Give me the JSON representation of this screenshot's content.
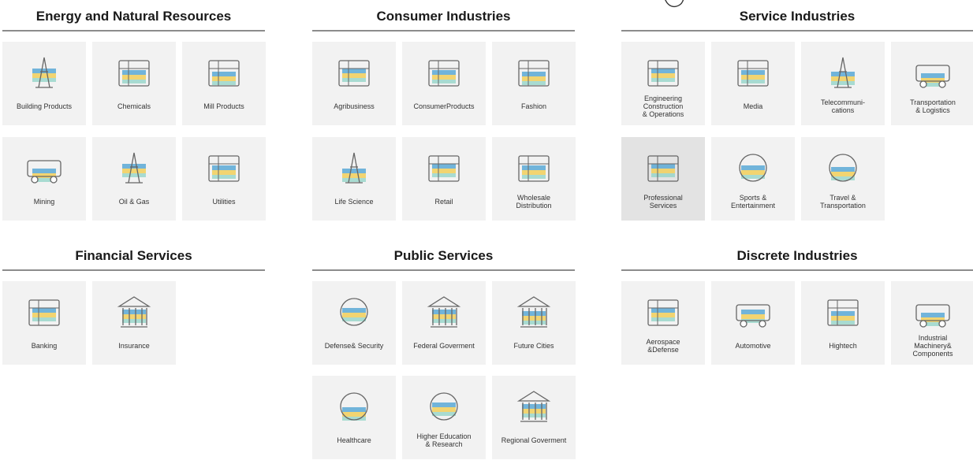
{
  "groups": {
    "energy": {
      "title": "Energy and  Natural Resources",
      "tiles": [
        {
          "label": "Building Products",
          "icon": "crane-building-icon"
        },
        {
          "label": "Chemicals",
          "icon": "chemical-plant-icon"
        },
        {
          "label": "Mill Products",
          "icon": "mill-rack-icon"
        },
        {
          "label": "Mining",
          "icon": "mine-cart-icon"
        },
        {
          "label": "Oil & Gas",
          "icon": "oil-rig-icon"
        },
        {
          "label": "Utilities",
          "icon": "power-plug-icon"
        }
      ]
    },
    "consumer": {
      "title": "Consumer Industries",
      "tiles": [
        {
          "label": "Agribusiness",
          "icon": "tractor-icon"
        },
        {
          "label": "ConsumerProducts",
          "icon": "shopping-bag-icon"
        },
        {
          "label": "Fashion",
          "icon": "dress-on-hanger-icon"
        },
        {
          "label": "Life Science",
          "icon": "microscope-icon"
        },
        {
          "label": "Retail",
          "icon": "retail-shoppers-icon"
        },
        {
          "label": "Wholesale\nDistribution",
          "icon": "forklift-worker-icon"
        }
      ]
    },
    "service": {
      "title": "Service Industries",
      "tiles": [
        {
          "label": "Engineering\nConstruction\n& Operations",
          "icon": "engineering-machine-icon"
        },
        {
          "label": "Media",
          "icon": "media-bubbles-icon"
        },
        {
          "label": "Telecommuni-\ncations",
          "icon": "antenna-tower-icon"
        },
        {
          "label": "Transportation\n& Logistics",
          "icon": "delivery-truck-icon"
        },
        {
          "label": "Professional\nServices",
          "icon": "briefcase-icon"
        },
        {
          "label": "Sports &\nEntertainment",
          "icon": "soccer-ball-icon"
        },
        {
          "label": "Travel &\nTransportation",
          "icon": "globe-icon"
        }
      ]
    },
    "financial": {
      "title": "Financial Services",
      "tiles": [
        {
          "label": "Banking",
          "icon": "money-stack-icon"
        },
        {
          "label": "Insurance",
          "icon": "insurance-house-icon"
        }
      ]
    },
    "public": {
      "title": "Public Services",
      "tiles": [
        {
          "label": "Defense& Security",
          "icon": "shield-icon"
        },
        {
          "label": "Federal Goverment",
          "icon": "capitol-building-icon"
        },
        {
          "label": "Future Cities",
          "icon": "city-skyline-icon"
        },
        {
          "label": "Healthcare",
          "icon": "medical-cross-icon"
        },
        {
          "label": "Higher Education\n& Research",
          "icon": "graduation-globe-icon"
        },
        {
          "label": "Regional Goverment",
          "icon": "columns-building-icon"
        }
      ]
    },
    "discrete": {
      "title": "Discrete Industries",
      "tiles": [
        {
          "label": "Aerospace\n&Defense",
          "icon": "airplane-icon"
        },
        {
          "label": "Automotive",
          "icon": "car-icon"
        },
        {
          "label": "Hightech",
          "icon": "circuit-chip-icon"
        },
        {
          "label": "Industrial\nMachinery&\nComponents",
          "icon": "conveyor-belt-icon"
        }
      ]
    }
  },
  "selected_tile": "Professional\nServices",
  "colors": {
    "tile_bg": "#f2f2f2",
    "tile_selected_bg": "#e3e3e3",
    "rule": "#8c8c8c",
    "accent_blue": "#5aa9d6",
    "accent_yellow": "#f2cf5b",
    "accent_teal": "#8fd3c6",
    "line_gray": "#666666"
  }
}
